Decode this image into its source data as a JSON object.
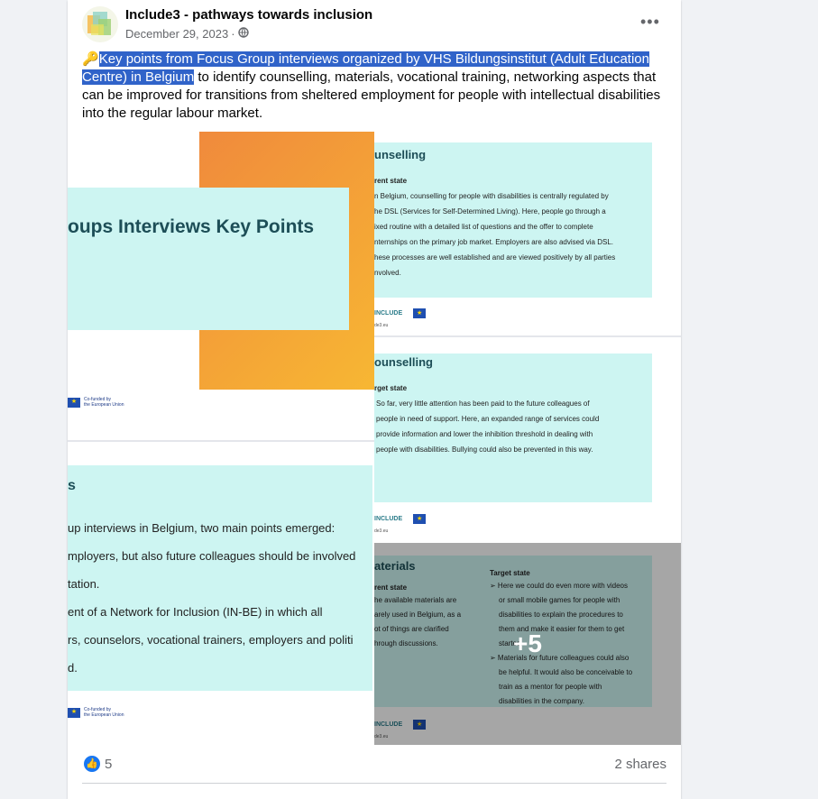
{
  "post": {
    "author": "Include3 - pathways towards inclusion",
    "date": "December 29, 2023",
    "separator": "·",
    "emoji": "🔑",
    "highlighted_text": "Key points from Focus Group interviews organized by VHS Bildungsinstitut (Adult Education Centre) in Belgium",
    "rest_text": " to identify counselling, materials, vocational training, networking aspects that can be improved for transitions from sheltered employment for people with intellectual disabilities into the regular labour market.",
    "more_menu": "•••"
  },
  "slides": {
    "title_slide": {
      "title": "oups Interviews Key Points",
      "eu_line1": "Co-funded by",
      "eu_line2": "the European Union"
    },
    "counselling_current": {
      "heading": "unselling",
      "subheading": "rent state",
      "lines": [
        "n Belgium, counselling for people with disabilities is centrally regulated by",
        "he DSL (Services for Self-Determined Living). Here, people go through a",
        "ixed routine with a detailed list of questions and the offer to complete",
        "nternships on the primary job market. Employers are also advised via DSL.",
        "hese processes are well established and are viewed positively by all parties",
        "nvolved."
      ],
      "logo": "INCLUDE",
      "site": "de3.eu"
    },
    "counselling_target": {
      "heading": "ounselling",
      "subheading": "rget state",
      "lines": [
        "So far, very little attention has been paid to the future colleagues of",
        "people in need of support. Here, an expanded range of services could",
        "provide information and lower the inhibition threshold in dealing with",
        "people with disabilities. Bullying could also be prevented in this way."
      ],
      "logo": "INCLUDE",
      "site": "de3.eu"
    },
    "summary_slide": {
      "heading": "s",
      "lines": [
        "up interviews in Belgium, two main points emerged:",
        "mployers, but also future colleagues should be involved",
        "tation.",
        "ent of a Network for Inclusion (IN-BE) in which all",
        "rs, counselors, vocational trainers, employers and politi",
        "d."
      ],
      "eu_line1": "Co-funded by",
      "eu_line2": "the European Union"
    },
    "materials": {
      "heading": "aterials",
      "left_sub": "rent state",
      "left_lines": [
        "he available materials are",
        "arely used in Belgium, as a",
        "ot of things are clarified",
        "hrough discussions."
      ],
      "right_sub": "Target state",
      "right_lines": [
        "➢  Here we could do even more with videos",
        "or small mobile games for people with",
        "disabilities to explain the procedures to",
        "them and make it easier for them to get",
        "started.",
        "➢  Materials for future colleagues could also",
        "be helpful. It would also be conceivable to",
        "train as a mentor for people with",
        "disabilities in the company."
      ],
      "logo": "INCLUDE",
      "site": "de3.eu",
      "overlay_count": "+5"
    }
  },
  "footer": {
    "like_count": "5",
    "shares": "2 shares"
  },
  "colors": {
    "highlight": "#3063c9",
    "slide_bg": "#cdf5f2",
    "accent_orange": "#f08a3c",
    "like_blue": "#1877f2"
  }
}
